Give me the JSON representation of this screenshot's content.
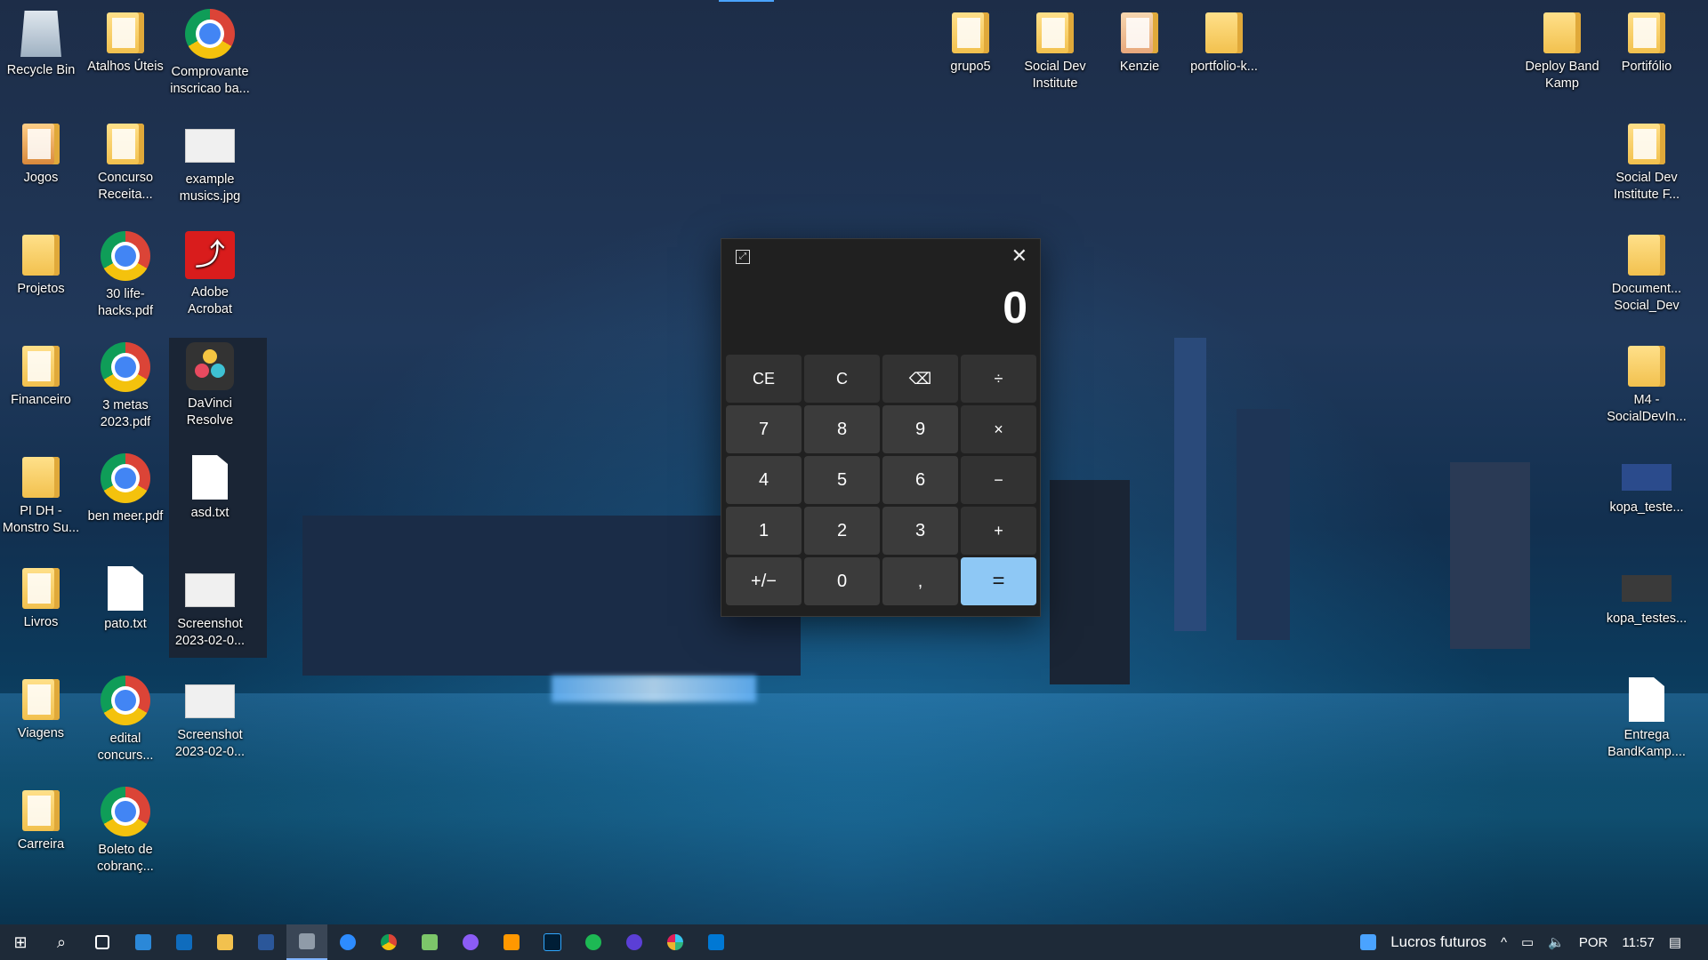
{
  "desktop": {
    "icons": [
      {
        "name": "recycle-bin",
        "label": "Recycle Bin"
      },
      {
        "name": "atalhos",
        "label": "Atalhos Úteis"
      },
      {
        "name": "comprovante",
        "label": "Comprovante inscricao ba..."
      },
      {
        "name": "grupo5",
        "label": "grupo5"
      },
      {
        "name": "social-dev-institute",
        "label": "Social Dev Institute"
      },
      {
        "name": "kenzie",
        "label": "Kenzie"
      },
      {
        "name": "portfolio-k",
        "label": "portfolio-k..."
      },
      {
        "name": "deploy-band",
        "label": "Deploy Band Kamp"
      },
      {
        "name": "portfolio",
        "label": "Portifólio"
      },
      {
        "name": "jogos",
        "label": "Jogos"
      },
      {
        "name": "concurso",
        "label": "Concurso Receita..."
      },
      {
        "name": "example-musics",
        "label": "example musics.jpg"
      },
      {
        "name": "social-dev-institute-f",
        "label": "Social Dev Institute F..."
      },
      {
        "name": "projetos",
        "label": "Projetos"
      },
      {
        "name": "lifehacks",
        "label": "30 life-hacks.pdf"
      },
      {
        "name": "adobe-acrobat",
        "label": "Adobe Acrobat"
      },
      {
        "name": "document-social",
        "label": "Document... Social_Dev"
      },
      {
        "name": "financeiro",
        "label": "Financeiro"
      },
      {
        "name": "metas",
        "label": "3 metas 2023.pdf"
      },
      {
        "name": "davinci",
        "label": "DaVinci Resolve"
      },
      {
        "name": "m4",
        "label": "M4 - SocialDevIn..."
      },
      {
        "name": "pi-dh",
        "label": "PI DH - Monstro Su..."
      },
      {
        "name": "ben-meer",
        "label": "ben meer.pdf"
      },
      {
        "name": "asd",
        "label": "asd.txt"
      },
      {
        "name": "kopa-teste",
        "label": "kopa_teste..."
      },
      {
        "name": "livros",
        "label": "Livros"
      },
      {
        "name": "pato",
        "label": "pato.txt"
      },
      {
        "name": "screenshot1",
        "label": "Screenshot 2023-02-0..."
      },
      {
        "name": "kopa-testes",
        "label": "kopa_testes..."
      },
      {
        "name": "viagens",
        "label": "Viagens"
      },
      {
        "name": "edital",
        "label": "edital concurs..."
      },
      {
        "name": "screenshot2",
        "label": "Screenshot 2023-02-0..."
      },
      {
        "name": "entrega",
        "label": "Entrega BandKamp...."
      },
      {
        "name": "carreira",
        "label": "Carreira"
      },
      {
        "name": "boleto",
        "label": "Boleto de cobranç..."
      }
    ]
  },
  "calculator": {
    "display": "0",
    "close": "✕",
    "expand": "⤢",
    "keys": [
      "CE",
      "C",
      "⌫",
      "÷",
      "7",
      "8",
      "9",
      "×",
      "4",
      "5",
      "6",
      "−",
      "1",
      "2",
      "3",
      "+",
      "+/−",
      "0",
      ",",
      "="
    ]
  },
  "taskbar": {
    "start": "⊞",
    "search": "⌕",
    "widget_label": "Lucros futuros",
    "lang": "POR",
    "time": "11:57",
    "chevron": "^",
    "colors": {
      "accent": "#8ec8f5",
      "taskbar": "#1e2a38"
    }
  }
}
